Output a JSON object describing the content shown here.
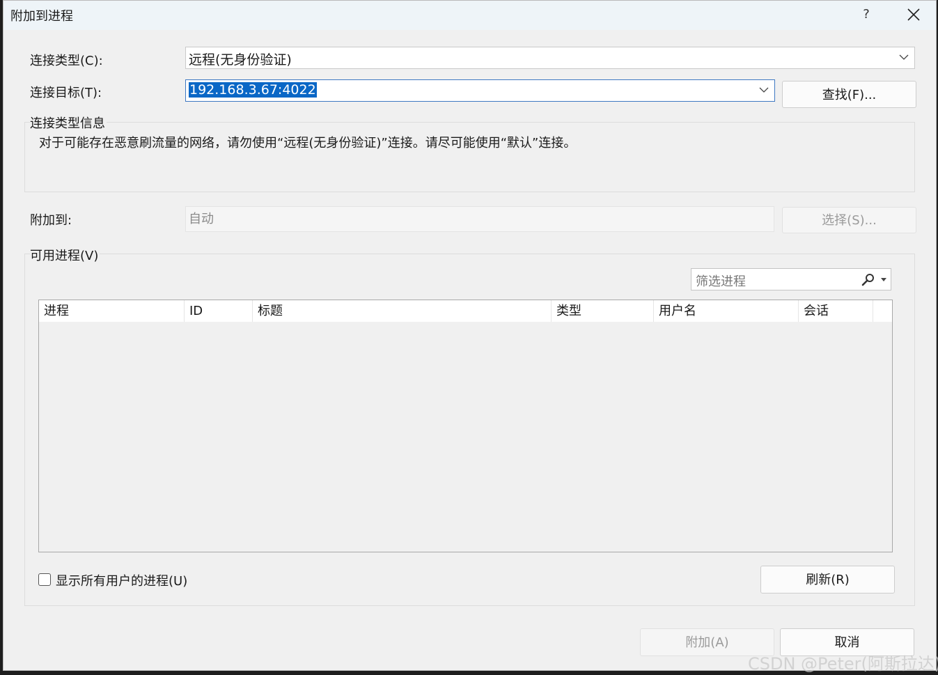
{
  "window": {
    "title": "附加到进程",
    "help_label": "?",
    "close_icon": "close-icon"
  },
  "connection": {
    "type_label": "连接类型(C):",
    "type_value": "远程(无身份验证)",
    "target_label": "连接目标(T):",
    "target_value": "192.168.3.67:4022",
    "find_button": "查找(F)..."
  },
  "info": {
    "group_title": "连接类型信息",
    "text": "对于可能存在恶意刷流量的网络，请勿使用“远程(无身份验证)”连接。请尽可能使用“默认”连接。"
  },
  "attach_to": {
    "label": "附加到:",
    "value": "自动",
    "select_button": "选择(S)..."
  },
  "processes": {
    "group_title": "可用进程(V)",
    "filter_placeholder": "筛选进程",
    "columns": [
      "进程",
      "ID",
      "标题",
      "类型",
      "用户名",
      "会话"
    ],
    "rows": [],
    "show_all_users_label": "显示所有用户的进程(U)",
    "show_all_users_checked": false,
    "refresh_button": "刷新(R)"
  },
  "footer": {
    "attach_button": "附加(A)",
    "cancel_button": "取消"
  },
  "watermark": "CSDN @Peter(阿斯拉达)",
  "colors": {
    "selection": "#0a67c6",
    "dialog_bg": "#f0f0f0",
    "titlebar_bg": "#eef4f8"
  }
}
